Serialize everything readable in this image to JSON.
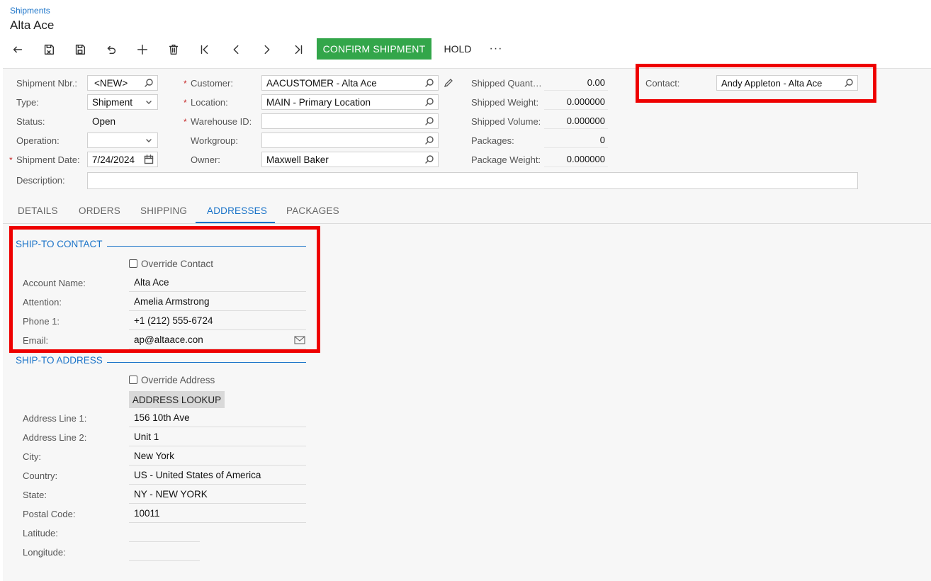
{
  "header": {
    "breadcrumb": "Shipments",
    "title": "Alta Ace"
  },
  "toolbar": {
    "icons": [
      "back-arrow-icon",
      "save-close-icon",
      "save-icon",
      "undo-icon",
      "add-icon",
      "delete-icon",
      "first-record-icon",
      "previous-icon",
      "next-icon",
      "last-record-icon"
    ],
    "confirm_label": "CONFIRM SHIPMENT",
    "hold_label": "HOLD",
    "more_label": "···",
    "confirm_color": "#33a64a"
  },
  "form": {
    "shipment_nbr": {
      "label": "Shipment Nbr.:",
      "value": "<NEW>"
    },
    "type": {
      "label": "Type:",
      "value": "Shipment"
    },
    "status": {
      "label": "Status:",
      "value": "Open"
    },
    "operation": {
      "label": "Operation:",
      "value": ""
    },
    "shipment_date": {
      "label": "Shipment Date:",
      "value": "7/24/2024"
    },
    "description": {
      "label": "Description:",
      "value": ""
    },
    "customer": {
      "label": "Customer:",
      "value": "AACUSTOMER - Alta Ace"
    },
    "location": {
      "label": "Location:",
      "value": "MAIN - Primary Location"
    },
    "warehouse_id": {
      "label": "Warehouse ID:",
      "value": ""
    },
    "workgroup": {
      "label": "Workgroup:",
      "value": ""
    },
    "owner": {
      "label": "Owner:",
      "value": "Maxwell Baker"
    },
    "shipped_quantity": {
      "label": "Shipped Quant…",
      "value": "0.00"
    },
    "shipped_weight": {
      "label": "Shipped Weight:",
      "value": "0.000000"
    },
    "shipped_volume": {
      "label": "Shipped Volume:",
      "value": "0.000000"
    },
    "packages": {
      "label": "Packages:",
      "value": "0"
    },
    "package_weight": {
      "label": "Package Weight:",
      "value": "0.000000"
    },
    "contact": {
      "label": "Contact:",
      "value": "Andy Appleton - Alta Ace"
    }
  },
  "tabs": [
    {
      "label": "DETAILS"
    },
    {
      "label": "ORDERS"
    },
    {
      "label": "SHIPPING"
    },
    {
      "label": "ADDRESSES"
    },
    {
      "label": "PACKAGES"
    }
  ],
  "active_tab": "ADDRESSES",
  "ship_to_contact": {
    "title": "SHIP-TO CONTACT",
    "override_label": "Override Contact",
    "rows": [
      {
        "label": "Account Name:",
        "value": "Alta Ace"
      },
      {
        "label": "Attention:",
        "value": "Amelia Armstrong"
      },
      {
        "label": "Phone 1:",
        "value": "+1 (212) 555-6724"
      },
      {
        "label": "Email:",
        "value": "ap@altaace.con"
      }
    ]
  },
  "ship_to_address": {
    "title": "SHIP-TO ADDRESS",
    "override_label": "Override Address",
    "lookup_label": "ADDRESS LOOKUP",
    "rows": [
      {
        "label": "Address Line 1:",
        "value": "156 10th Ave"
      },
      {
        "label": "Address Line 2:",
        "value": "Unit 1"
      },
      {
        "label": "City:",
        "value": "New York"
      },
      {
        "label": "Country:",
        "value": "US - United States of America"
      },
      {
        "label": "State:",
        "value": "NY - NEW YORK"
      },
      {
        "label": "Postal Code:",
        "value": "10011"
      },
      {
        "label": "Latitude:",
        "value": ""
      },
      {
        "label": "Longitude:",
        "value": ""
      }
    ]
  },
  "colors": {
    "accent": "#1a73c8",
    "highlight": "#ee0000"
  }
}
